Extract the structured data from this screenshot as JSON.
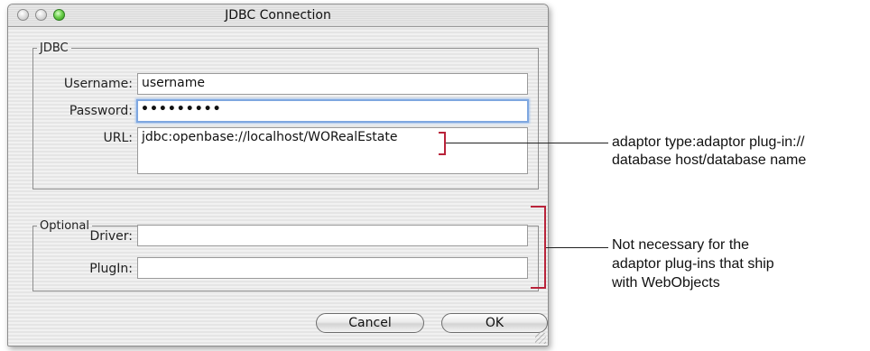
{
  "window": {
    "title": "JDBC Connection"
  },
  "jdbc_group": {
    "legend": "JDBC",
    "username_label": "Username:",
    "username_value": "username",
    "password_label": "Password:",
    "password_value": "•••••••••",
    "url_label": "URL:",
    "url_value": "jdbc:openbase://localhost/WORealEstate"
  },
  "optional_group": {
    "legend": "Optional",
    "driver_label": "Driver:",
    "driver_value": "",
    "plugin_label": "PlugIn:",
    "plugin_value": ""
  },
  "buttons": {
    "cancel": "Cancel",
    "ok": "OK"
  },
  "annotations": {
    "url_note_line1": "adaptor type:adaptor plug-in://",
    "url_note_line2": "database host/database name",
    "optional_note_line1": "Not necessary for the",
    "optional_note_line2": "adaptor plug-ins that ship",
    "optional_note_line3": "with WebObjects"
  },
  "colors": {
    "callout_bracket": "#b9233a",
    "focus_ring": "#7ea7e0",
    "zoom_button": "#6fd14f"
  }
}
